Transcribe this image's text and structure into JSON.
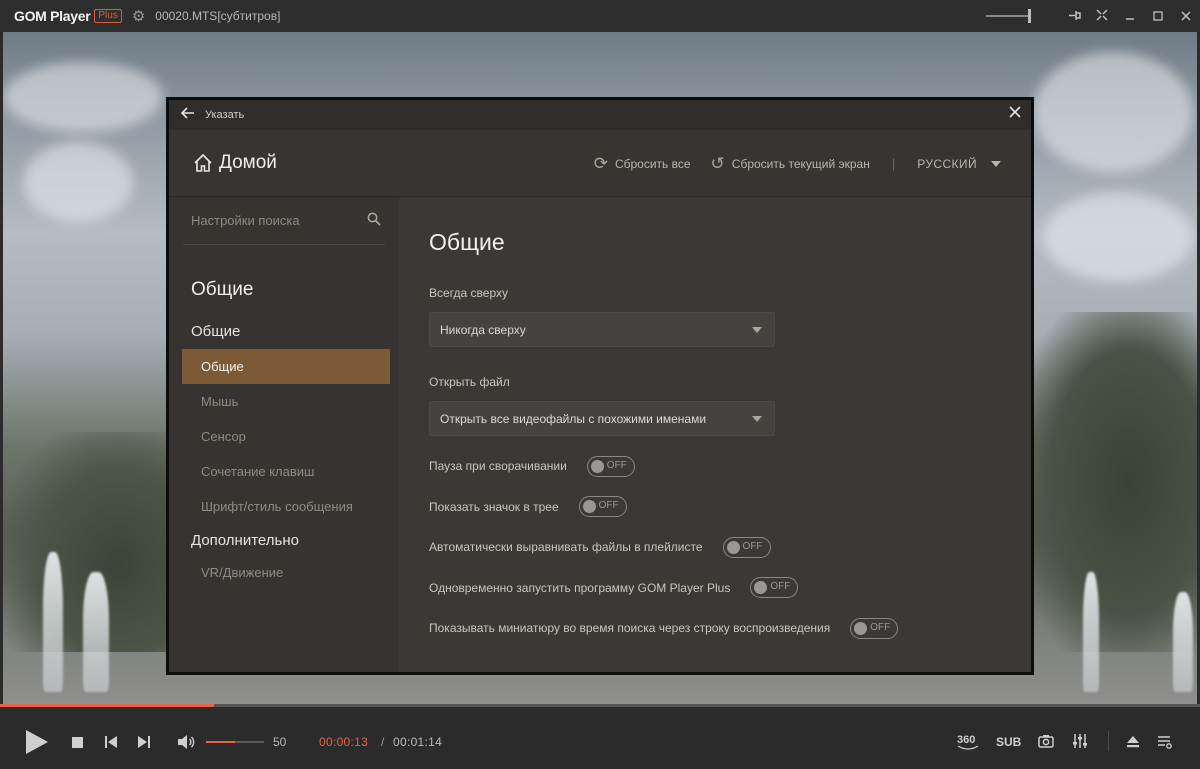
{
  "titlebar": {
    "app_name": "GOM Player",
    "plus_badge": "Plus",
    "file_title": "00020.MTS[субтитров]",
    "icons": [
      "gear-icon",
      "pin-icon",
      "compact-icon",
      "minimize-icon",
      "maximize-icon",
      "close-icon"
    ]
  },
  "dialog": {
    "top_title": "Указать",
    "home_label": "Домой",
    "reset_all": "Сбросить все",
    "reset_current": "Сбросить текущий экран",
    "separator": "|",
    "language": "РУССКИЙ",
    "search_placeholder": "Настройки поиска",
    "sidebar": {
      "section": "Общие",
      "group_general": "Общие",
      "items": [
        {
          "label": "Общие",
          "active": true
        },
        {
          "label": "Мышь",
          "active": false
        },
        {
          "label": "Сенсор",
          "active": false
        },
        {
          "label": "Сочетание клавиш",
          "active": false
        },
        {
          "label": "Шрифт/стиль сообщения",
          "active": false
        }
      ],
      "group_advanced": "Дополнительно",
      "advanced_items": [
        {
          "label": "VR/Движение"
        }
      ]
    },
    "content": {
      "title": "Общие",
      "always_on_top_label": "Всегда сверху",
      "always_on_top_value": "Никогда сверху",
      "open_file_label": "Открыть файл",
      "open_file_value": "Открыть все видеофайлы с похожими именами",
      "toggles": [
        {
          "label": "Пауза при сворачивании",
          "state": "OFF"
        },
        {
          "label": "Показать значок в трее",
          "state": "OFF"
        },
        {
          "label": "Автоматически выравнивать файлы в плейлисте",
          "state": "OFF"
        },
        {
          "label": "Одновременно запустить программу GOM Player Plus",
          "state": "OFF"
        },
        {
          "label": "Показывать миниатюру во время поиска через строку воспроизведения",
          "state": "OFF"
        }
      ]
    }
  },
  "player": {
    "progress_fraction": 0.178,
    "volume_fraction": 0.5,
    "volume_value": "50",
    "time_current": "00:00:13",
    "time_sep": "/",
    "time_total": "00:01:14",
    "btn_360": "360",
    "btn_sub": "SUB"
  },
  "colors": {
    "accent": "#e8634a",
    "active_item": "#7b5a35",
    "dialog_bg": "#3b3835"
  }
}
